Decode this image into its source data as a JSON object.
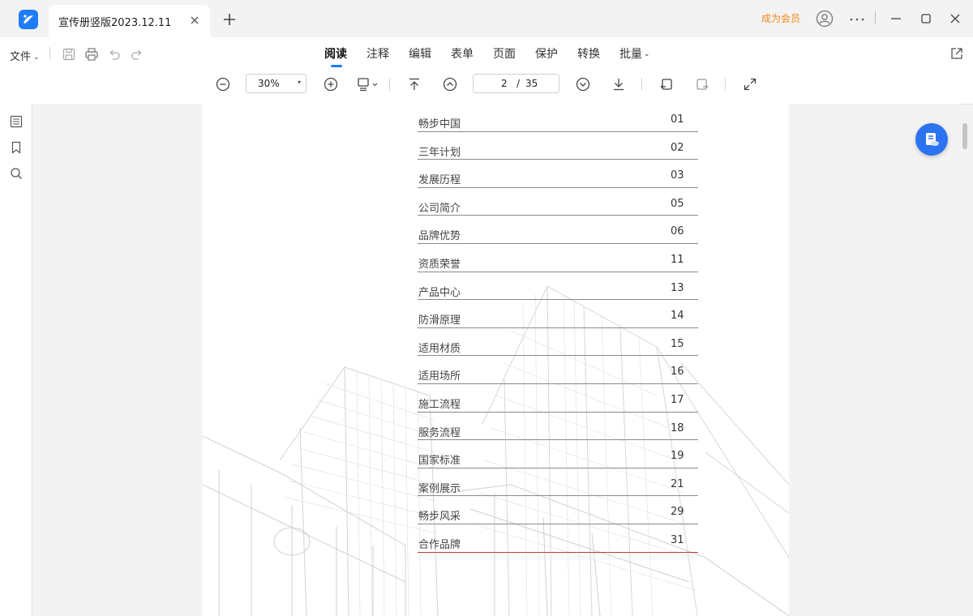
{
  "tab": {
    "title": "宣传册竖版2023.12.11"
  },
  "titlebar": {
    "vip_label": "成为会员"
  },
  "toolbar": {
    "file_label": "文件",
    "menu_tabs": [
      {
        "label": "阅读",
        "active": true
      },
      {
        "label": "注释"
      },
      {
        "label": "编辑"
      },
      {
        "label": "表单"
      },
      {
        "label": "页面"
      },
      {
        "label": "保护"
      },
      {
        "label": "转换"
      },
      {
        "label": "批量"
      }
    ],
    "zoom": "30%",
    "page_current": "2",
    "page_separator": "/",
    "page_total": "35"
  },
  "toc": [
    {
      "title": "畅步中国",
      "page": "01"
    },
    {
      "title": "三年计划",
      "page": "02"
    },
    {
      "title": "发展历程",
      "page": "03"
    },
    {
      "title": "公司简介",
      "page": "05"
    },
    {
      "title": "品牌优势",
      "page": "06"
    },
    {
      "title": "资质荣誉",
      "page": "11"
    },
    {
      "title": "产品中心",
      "page": "13"
    },
    {
      "title": "防滑原理",
      "page": "14"
    },
    {
      "title": "适用材质",
      "page": "15"
    },
    {
      "title": "适用场所",
      "page": "16"
    },
    {
      "title": "施工流程",
      "page": "17"
    },
    {
      "title": "服务流程",
      "page": "18"
    },
    {
      "title": "国家标准",
      "page": "19"
    },
    {
      "title": "案例展示",
      "page": "21"
    },
    {
      "title": "畅步风采",
      "page": "29"
    },
    {
      "title": "合作品牌",
      "page": "31"
    }
  ],
  "colors": {
    "accent": "#1e7cf5",
    "vip": "#f08a1c",
    "toc_last_rule": "#c0392b"
  }
}
